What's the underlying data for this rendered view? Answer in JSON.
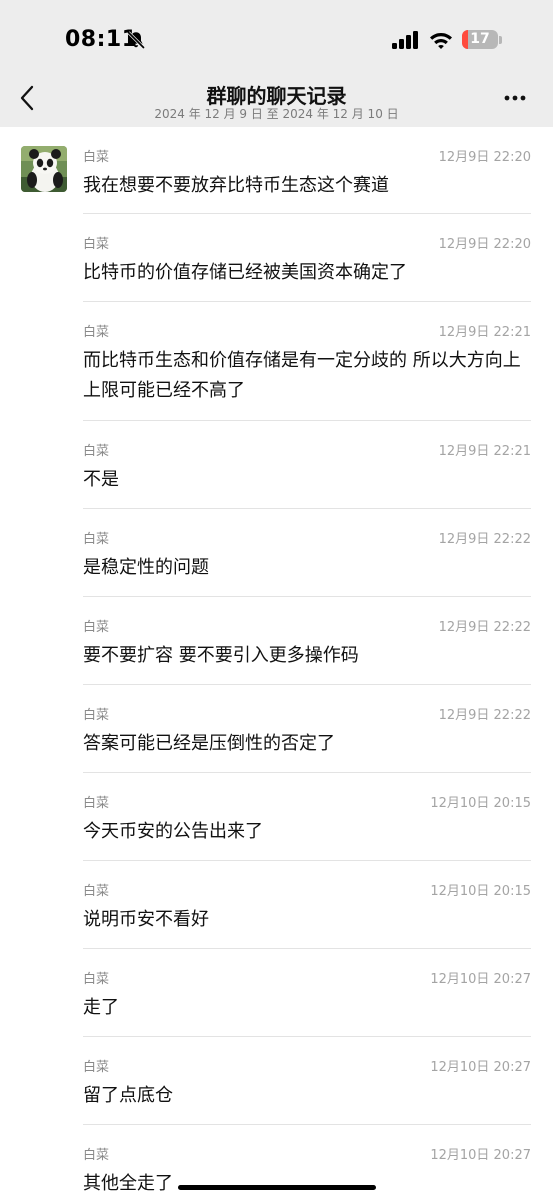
{
  "status_bar": {
    "time": "08:11",
    "battery_level": "17"
  },
  "header": {
    "title": "群聊的聊天记录",
    "subtitle": "2024 年 12 月 9 日 至 2024 年 12 月 10 日"
  },
  "colors": {
    "header_background": "#ededed",
    "battery_low": "#ff4b3e",
    "divider": "#e3e3e3"
  },
  "icons": {
    "back": "chevron-left-icon",
    "more": "more-dots-icon",
    "avatar": "panda-avatar"
  },
  "messages": [
    {
      "sender": "白菜",
      "time": "12月9日 22:20",
      "text": "我在想要不要放弃比特币生态这个赛道"
    },
    {
      "sender": "白菜",
      "time": "12月9日 22:20",
      "text": "比特币的价值存储已经被美国资本确定了"
    },
    {
      "sender": "白菜",
      "time": "12月9日 22:21",
      "text": "而比特币生态和价值存储是有一定分歧的 所以大方向上上限可能已经不高了"
    },
    {
      "sender": "白菜",
      "time": "12月9日 22:21",
      "text": "不是"
    },
    {
      "sender": "白菜",
      "time": "12月9日 22:22",
      "text": "是稳定性的问题"
    },
    {
      "sender": "白菜",
      "time": "12月9日 22:22",
      "text": "要不要扩容 要不要引入更多操作码"
    },
    {
      "sender": "白菜",
      "time": "12月9日 22:22",
      "text": "答案可能已经是压倒性的否定了"
    },
    {
      "sender": "白菜",
      "time": "12月10日 20:15",
      "text": "今天币安的公告出来了"
    },
    {
      "sender": "白菜",
      "time": "12月10日 20:15",
      "text": "说明币安不看好"
    },
    {
      "sender": "白菜",
      "time": "12月10日 20:27",
      "text": "走了"
    },
    {
      "sender": "白菜",
      "time": "12月10日 20:27",
      "text": "留了点底仓"
    },
    {
      "sender": "白菜",
      "time": "12月10日 20:27",
      "text": "其他全走了"
    }
  ]
}
